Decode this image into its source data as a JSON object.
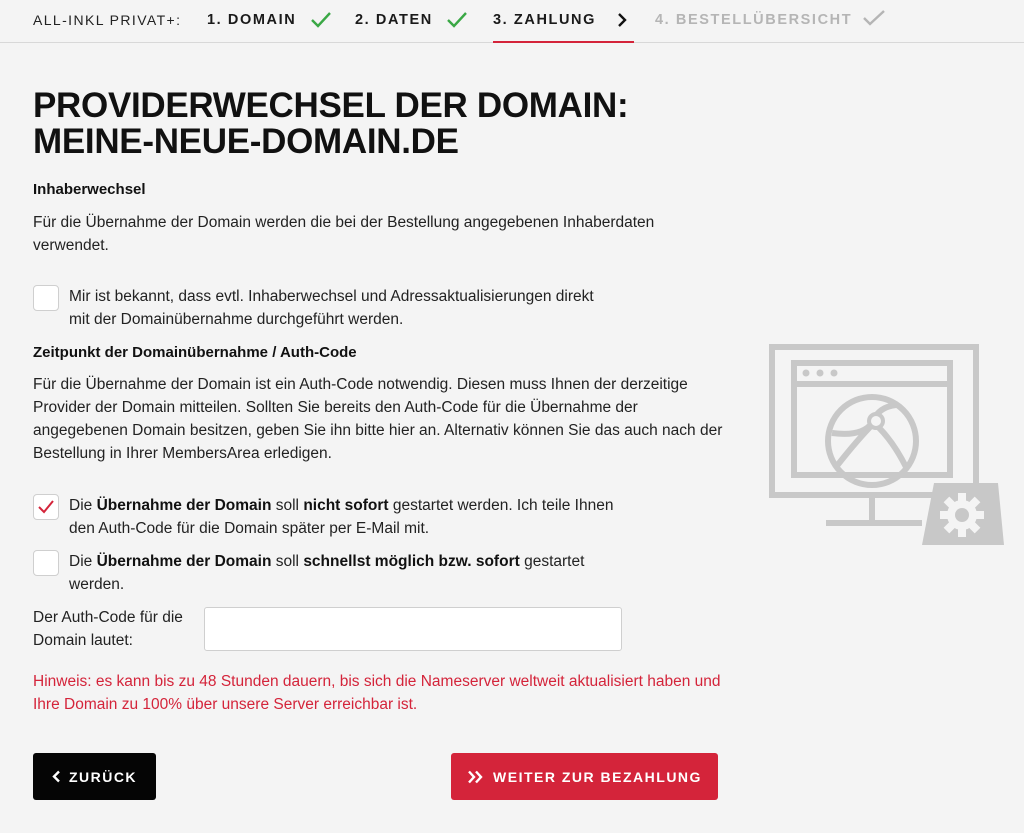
{
  "stepbar": {
    "brand": "ALL-INKL PRIVAT+:",
    "steps": [
      {
        "label": "1. DOMAIN",
        "state": "done"
      },
      {
        "label": "2. DATEN",
        "state": "done"
      },
      {
        "label": "3. ZAHLUNG",
        "state": "active"
      },
      {
        "label": "4. BESTELLÜBERSICHT",
        "state": "pending"
      }
    ]
  },
  "page": {
    "title_line1": "PROVIDERWECHSEL DER DOMAIN:",
    "title_line2": "MEINE-NEUE-DOMAIN.DE"
  },
  "owner": {
    "heading": "Inhaberwechsel",
    "text": "Für die Übernahme der Domain werden die bei der Bestellung angegebenen Inhaberdaten verwendet.",
    "checkbox_line1": "Mir ist bekannt, dass evtl. Inhaberwechsel und Adressaktualisierungen direkt",
    "checkbox_line2": "mit der Domainübernahme durchgeführt werden.",
    "checked": false
  },
  "authcode": {
    "heading": "Zeitpunkt der Domainübernahme / Auth-Code",
    "text": "Für die Übernahme der Domain ist ein Auth-Code notwendig. Diesen muss Ihnen der derzeitige Provider der Domain mitteilen. Sollten Sie bereits den Auth-Code für die Übernahme der angegebenen Domain besitzen, geben Sie ihn bitte hier an. Alternativ können Sie das auch nach der Bestellung in Ihrer MembersArea erledigen.",
    "option_later": {
      "checked": true,
      "p1": "Die ",
      "b1": "Übernahme der Domain",
      "p2": " soll ",
      "b2": "nicht sofort",
      "p3": " gestartet werden. Ich teile Ihnen",
      "line2": "den Auth-Code für die Domain später per E-Mail mit."
    },
    "option_now": {
      "checked": false,
      "p1": "Die ",
      "b1": "Übernahme der Domain",
      "p2": " soll ",
      "b2": "schnellst möglich bzw. sofort",
      "p3": " gestartet",
      "line2": "werden."
    },
    "field_label_line1": "Der Auth-Code für die",
    "field_label_line2": "Domain lautet:",
    "field_value": "",
    "hint": "Hinweis: es kann bis zu 48 Stunden dauern, bis sich die Nameserver weltweit aktualisiert haben und Ihre Domain zu 100% über unsere Server erreichbar ist."
  },
  "buttons": {
    "back": "ZURÜCK",
    "next": "WEITER ZUR BEZAHLUNG"
  },
  "colors": {
    "accent": "#d4243a",
    "success": "#3aa845",
    "muted": "#b5b5b5",
    "illustration": "#c8c8c8"
  },
  "icons": {
    "done": "check-icon",
    "next": "chevron-right-icon",
    "back": "chevron-left-icon",
    "forward": "double-chevron-right-icon",
    "illustration": "monitor-globe-gear-icon"
  }
}
